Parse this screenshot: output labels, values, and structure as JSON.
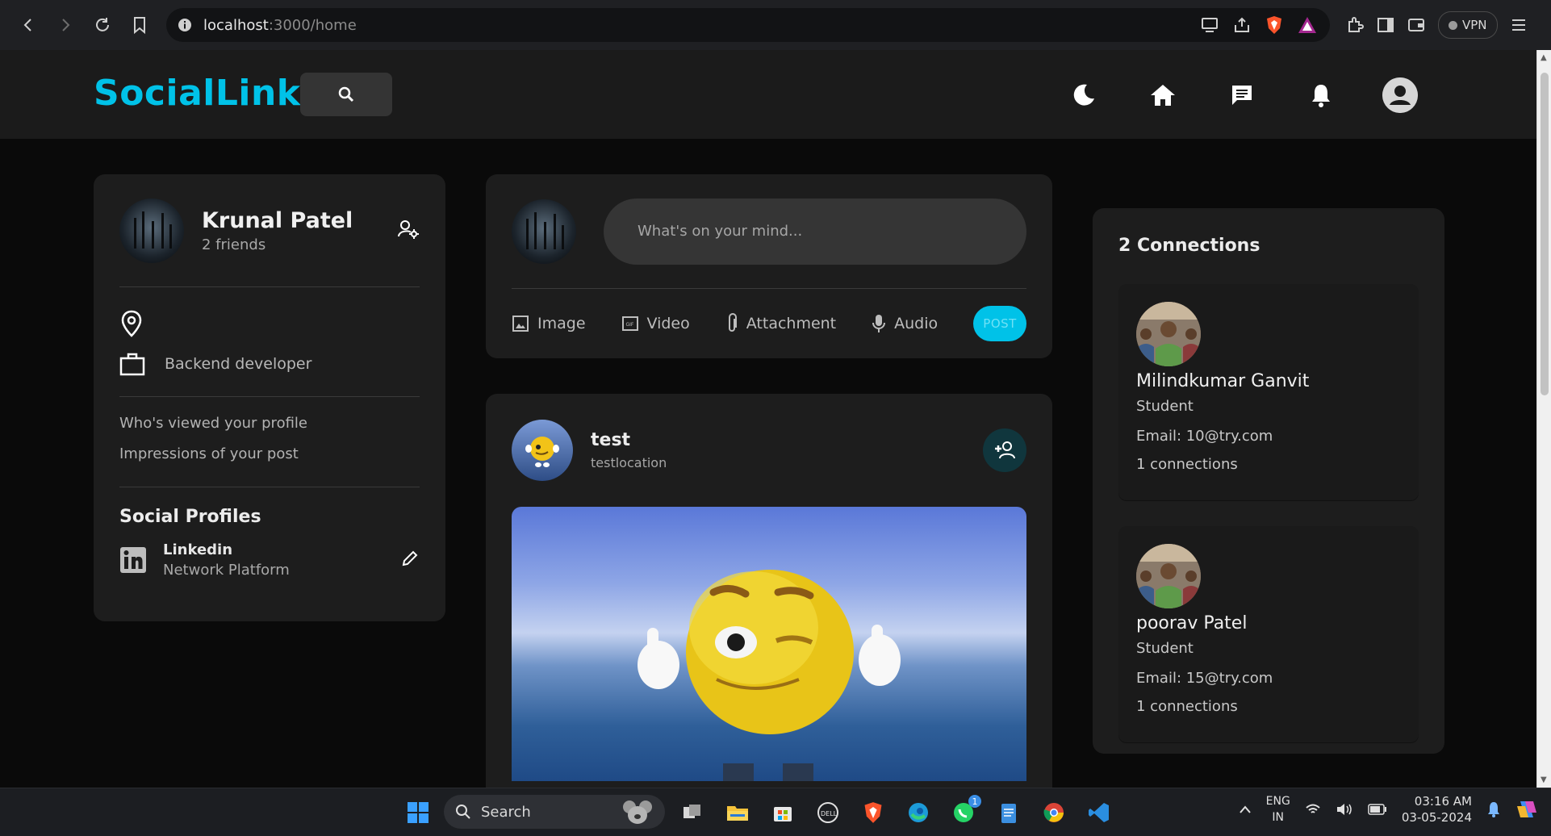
{
  "browser": {
    "url_host": "localhost",
    "url_path": ":3000/home",
    "vpn_label": "VPN"
  },
  "header": {
    "logo": "SocialLink",
    "accent": "#00c2e8"
  },
  "profile": {
    "name": "Krunal Patel",
    "friends": "2 friends",
    "occupation": "Backend developer",
    "stats": [
      "Who's viewed your profile",
      "Impressions of your post"
    ],
    "social_heading": "Social Profiles",
    "social": {
      "name": "Linkedin",
      "desc": "Network Platform"
    }
  },
  "composer": {
    "placeholder": "What's on your mind...",
    "actions": [
      "Image",
      "Video",
      "Attachment",
      "Audio"
    ],
    "post_label": "POST"
  },
  "post": {
    "author": "test",
    "location": "testlocation"
  },
  "connections": {
    "heading": "2 Connections",
    "items": [
      {
        "name": "Milindkumar Ganvit",
        "role": "Student",
        "email": "Email: 10@try.com",
        "count": "1 connections"
      },
      {
        "name": "poorav Patel",
        "role": "Student",
        "email": "Email: 15@try.com",
        "count": "1 connections"
      }
    ]
  },
  "taskbar": {
    "search_label": "Search",
    "lang_top": "ENG",
    "lang_bottom": "IN",
    "time": "03:16 AM",
    "date": "03-05-2024",
    "whatsapp_badge": "1"
  }
}
